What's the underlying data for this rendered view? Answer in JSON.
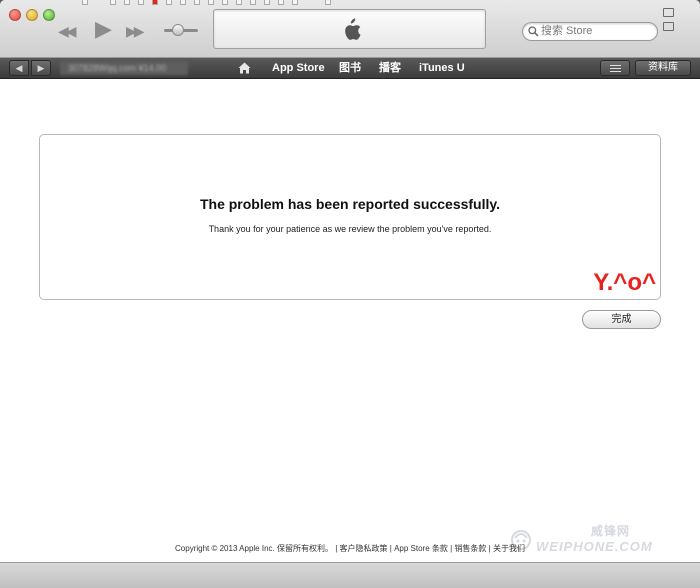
{
  "window": {
    "colors": {
      "nav_bg": "#4a4a4a",
      "accent_red": "#e8231e",
      "content_bg": "#ffffff"
    }
  },
  "player": {
    "prev_icon": "rewind-icon",
    "play_icon": "play-icon",
    "next_icon": "fast-forward-icon",
    "lcd_icon": "apple-logo-icon"
  },
  "search": {
    "placeholder": "搜索 Store",
    "icon": "search-icon"
  },
  "nav": {
    "back_glyph": "◀",
    "forward_glyph": "▶",
    "account_text": "307828Wqq.com  ¥14.00",
    "home_icon": "home-icon",
    "links": [
      {
        "label": "App Store"
      },
      {
        "label": "图书"
      },
      {
        "label": "播客"
      },
      {
        "label": "iTunes U"
      }
    ],
    "menu_icon": "list-icon",
    "library_label": "资料库"
  },
  "main": {
    "headline": "The problem has been reported successfully.",
    "message": "Thank you for your patience as we review the problem you've reported.",
    "watermark": "Y.^o^",
    "done_label": "完成",
    "footer": {
      "copyright": "Copyright © 2013 Apple Inc. 保留所有权利。",
      "links": [
        "客户隐私政策",
        "App Store 条款",
        "销售条款",
        "关于我们"
      ]
    },
    "site_mark": {
      "cn": "威锋网",
      "en": "WEIPHONE.COM"
    }
  }
}
